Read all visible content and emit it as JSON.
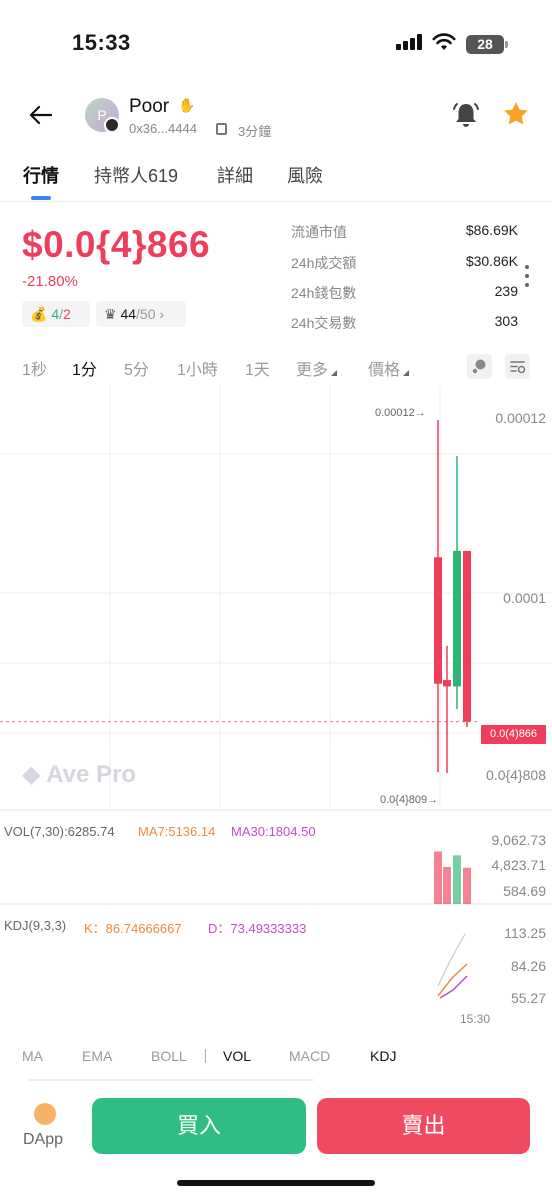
{
  "status_bar": {
    "time": "15:33",
    "battery": "28"
  },
  "header": {
    "token_name": "Poor",
    "avatar_letter": "P",
    "address": "0x36...4444",
    "age": "3分鐘"
  },
  "tabs": [
    {
      "label": "行情",
      "active": true
    },
    {
      "label": "持幣人619",
      "active": false
    },
    {
      "label": "詳細",
      "active": false
    },
    {
      "label": "風險",
      "active": false
    }
  ],
  "price": {
    "value": "$0.0{4}866",
    "change": "-21.80%",
    "pill1_green": "4",
    "pill1_sep": "/",
    "pill1_red": "2",
    "pill2_value": "44",
    "pill2_total": "/50"
  },
  "stats": [
    {
      "label": "流通市值",
      "value": "$86.69K"
    },
    {
      "label": "24h成交額",
      "value": "$30.86K"
    },
    {
      "label": "24h錢包數",
      "value": "239"
    },
    {
      "label": "24h交易數",
      "value": "303"
    }
  ],
  "intervals": [
    {
      "label": "1秒",
      "active": false
    },
    {
      "label": "1分",
      "active": true
    },
    {
      "label": "5分",
      "active": false
    },
    {
      "label": "1小時",
      "active": false
    },
    {
      "label": "1天",
      "active": false
    },
    {
      "label": "更多",
      "active": false,
      "dropdown": true
    },
    {
      "label": "價格",
      "active": false,
      "dropdown": true
    }
  ],
  "chart": {
    "watermark": "Ave Pro",
    "high_marker": "0.00012→",
    "low_marker": "0.0{4}809→",
    "price_axis": [
      "0.00012",
      "0.0001",
      "0.0{4}808"
    ],
    "current_price_tag": "0.0(4)866",
    "vol_legend": {
      "vol": "VOL(7,30):6285.74",
      "ma7": "MA7:5136.14",
      "ma30": "MA30:1804.50"
    },
    "vol_axis": [
      "9,062.73",
      "4,823.71",
      "584.69"
    ],
    "kdj_legend": {
      "kdj": "KDJ(9,3,3)",
      "k": "K：86.74666667",
      "d": "D：73.49333333"
    },
    "kdj_axis": [
      "113.25",
      "84.26",
      "55.27"
    ],
    "time_label": "15:30",
    "colors": {
      "up": "#2bb673",
      "down": "#ee3e5b",
      "k_line": "#f08a3c",
      "d_line": "#c04fc7",
      "j_line": "#c8c8c8"
    }
  },
  "chart_data": {
    "type": "candlestick",
    "interval": "1分",
    "candles": [
      {
        "open": 9.08e-05,
        "high": 0.00012,
        "low": 8.1e-05,
        "close": 0.0001048,
        "color": "down"
      },
      {
        "open": 9.12e-05,
        "high": 9.5e-05,
        "low": 8.09e-05,
        "close": 9.05e-05,
        "color": "down"
      },
      {
        "open": 9.05e-05,
        "high": 0.000116,
        "low": 8.8e-05,
        "close": 0.0001055,
        "color": "up"
      },
      {
        "open": 0.0001055,
        "high": 0.0001055,
        "low": 8.6e-05,
        "close": 8.66e-05,
        "color": "down"
      }
    ],
    "volume": {
      "values": [
        6800,
        4800,
        6300,
        4700
      ],
      "colors": [
        "down",
        "down",
        "up",
        "down"
      ]
    },
    "y_axis_ticks": [
      "0.00012",
      "0.0001",
      "0.0{4}808"
    ],
    "vol_axis_ticks": [
      "9,062.73",
      "4,823.71",
      "584.69"
    ],
    "kdj_axis_ticks": [
      "113.25",
      "84.26",
      "55.27"
    ],
    "x_label": "15:30"
  },
  "indicators": [
    {
      "label": "MA",
      "active": false
    },
    {
      "label": "EMA",
      "active": false
    },
    {
      "label": "BOLL",
      "active": false
    },
    {
      "label": "VOL",
      "active": true
    },
    {
      "label": "MACD",
      "active": false
    },
    {
      "label": "KDJ",
      "active": true
    }
  ],
  "bottom": {
    "dapp_label": "DApp",
    "buy_label": "買入",
    "sell_label": "賣出"
  }
}
